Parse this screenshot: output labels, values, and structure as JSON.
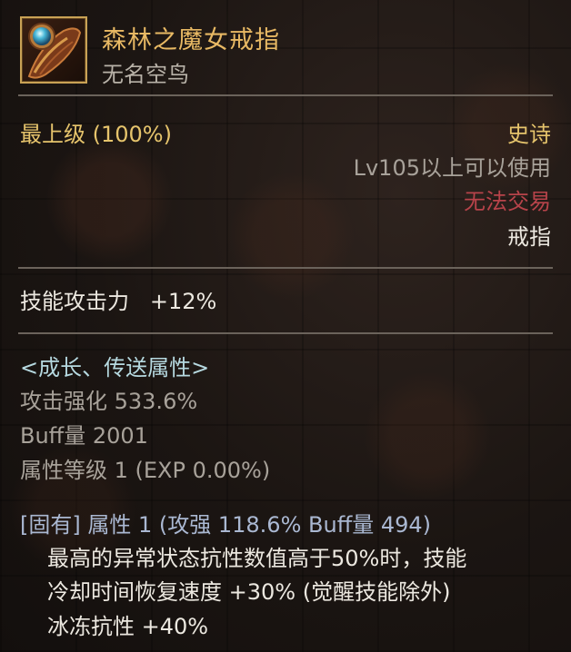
{
  "item": {
    "name": "森林之魔女戒指",
    "subtitle": "无名空鸟",
    "icon": "ring-icon"
  },
  "summary": {
    "grade": "最上级 (100%)",
    "rarity": "史诗",
    "level_req": "Lv105以上可以使用",
    "trade_status": "无法交易",
    "slot": "戒指"
  },
  "stats": {
    "skill_attack": "技能攻击力",
    "skill_attack_value": "+12%"
  },
  "growth": {
    "header": "<成长、传送属性>",
    "attack_boost": "攻击强化 533.6%",
    "buff_amount": "Buff量 2001",
    "attr_level": "属性等级 1 (EXP 0.00%)"
  },
  "inherent": {
    "header": "[固有] 属性 1 (攻强 118.6%    Buff量 494)",
    "desc_line1": "最高的异常状态抗性数值高于50%时，技能",
    "desc_line2": "冷却时间恢复速度 +30% (觉醒技能除外)",
    "desc_line3": "冰冻抗性 +40%"
  },
  "colors": {
    "name": "#e8b964",
    "rarity": "#e6c46c",
    "untradeable": "#b7434a",
    "divider": "#6b635b"
  }
}
